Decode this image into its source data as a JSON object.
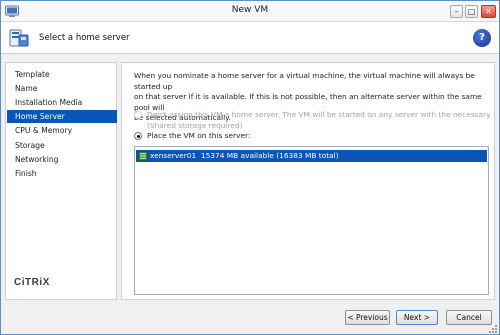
{
  "window": {
    "title": "New VM",
    "minimize_glyph": "–",
    "maximize_glyph": "□",
    "close_glyph": "✕"
  },
  "header": {
    "title": "Select a home server",
    "help_glyph": "?"
  },
  "sidebar": {
    "items": [
      {
        "label": "Template",
        "active": false
      },
      {
        "label": "Name",
        "active": false
      },
      {
        "label": "Installation Media",
        "active": false
      },
      {
        "label": "Home Server",
        "active": true
      },
      {
        "label": "CPU & Memory",
        "active": false
      },
      {
        "label": "Storage",
        "active": false
      },
      {
        "label": "Networking",
        "active": false
      },
      {
        "label": "Finish",
        "active": false
      }
    ],
    "brand": "CiTRiX"
  },
  "content": {
    "intro_line1": "When you nominate a home server for a virtual machine, the virtual machine will always be started up",
    "intro_line2": "on that server if it is available. If this is not possible, then an alternate server within the same pool will",
    "intro_line3": "be selected automatically.",
    "option_no_home": "Don't assign this VM a home server. The VM will be started on any server with the necessary",
    "option_no_home_sub": "(Shared storage required)",
    "option_place": "Place the VM on this server:",
    "selected_option": "option_place",
    "servers": [
      {
        "name": "xenserver01",
        "detail": "15374 MB available (16383 MB total)",
        "selected": true
      }
    ]
  },
  "buttons": {
    "previous": "< Previous",
    "next": "Next >",
    "cancel": "Cancel"
  },
  "colors": {
    "selection": "#0a55b8",
    "title_bar": "#f7f7f7",
    "close_button": "#d9473b"
  }
}
